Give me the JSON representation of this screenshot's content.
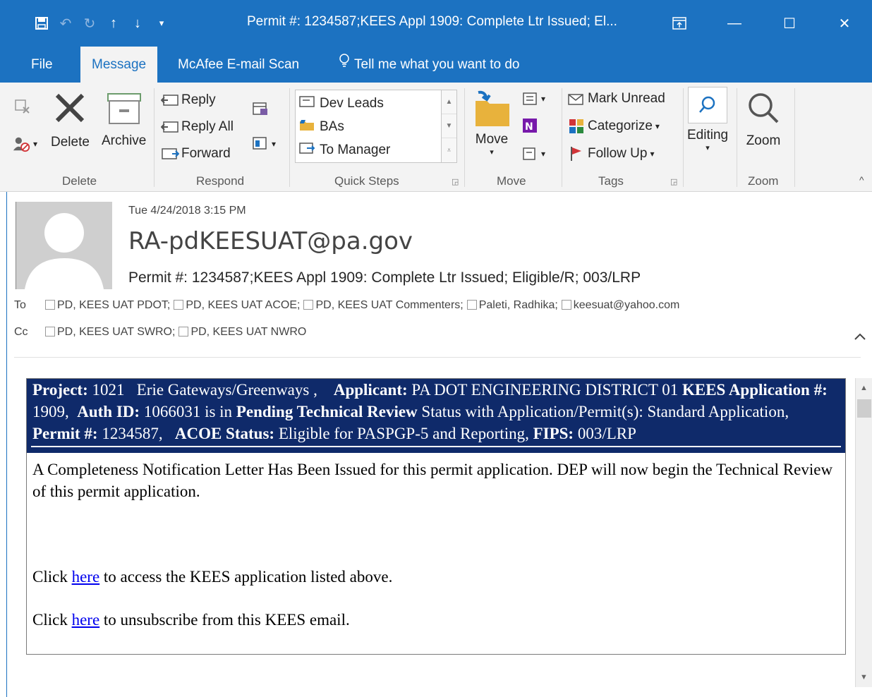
{
  "window": {
    "title": "Permit #: 1234587;KEES Appl 1909: Complete Ltr Issued; El...",
    "qat_icons": [
      "save-icon",
      "undo-icon",
      "redo-icon",
      "up-arrow-icon",
      "down-arrow-icon",
      "customize-icon"
    ],
    "controls": [
      "ribbon-display-icon",
      "minimize-icon",
      "maximize-icon",
      "close-icon"
    ]
  },
  "tabs": [
    {
      "label": "File"
    },
    {
      "label": "Message"
    },
    {
      "label": "McAfee E-mail Scan"
    },
    {
      "label": "Tell me what you want to do"
    }
  ],
  "ribbon": {
    "delete": {
      "delete_label": "Delete",
      "archive_label": "Archive",
      "group": "Delete"
    },
    "respond": {
      "reply": "Reply",
      "reply_all": "Reply All",
      "forward": "Forward",
      "group": "Respond"
    },
    "quick_steps": {
      "items": [
        "Dev Leads",
        "BAs",
        "To Manager"
      ],
      "group": "Quick Steps"
    },
    "move": {
      "move_label": "Move",
      "group": "Move"
    },
    "tags": {
      "mark_unread": "Mark Unread",
      "categorize": "Categorize",
      "follow_up": "Follow Up",
      "group": "Tags"
    },
    "editing": {
      "label": "Editing"
    },
    "zoom": {
      "label": "Zoom",
      "group": "Zoom"
    }
  },
  "header": {
    "date": "Tue 4/24/2018 3:15 PM",
    "sender": "RA-pdKEESUAT@pa.gov",
    "subject": "Permit #: 1234587;KEES Appl 1909: Complete Ltr Issued; Eligible/R; 003/LRP",
    "to_label": "To",
    "cc_label": "Cc",
    "to": [
      "PD, KEES UAT PDOT;",
      "PD, KEES UAT ACOE;",
      "PD, KEES UAT Commenters;",
      "Paleti, Radhika;",
      "keesuat@yahoo.com"
    ],
    "cc": [
      "PD, KEES UAT SWRO;",
      "PD, KEES UAT NWRO"
    ]
  },
  "body": {
    "banner": {
      "project_label": "Project:",
      "project_value": "1021   Erie Gateways/Greenways ,",
      "applicant_label": "Applicant:",
      "applicant_value": "PA DOT ENGINEERING DISTRICT 01",
      "app_label": "KEES Application #:",
      "app_value": "1909,",
      "auth_label": "Auth ID:",
      "auth_value": "1066031 is in",
      "status_label": "Pending Technical Review",
      "status_value": "Status with Application/Permit(s): Standard Application,",
      "permit_label": "Permit #:",
      "permit_value": "1234587,",
      "acoe_label": "ACOE Status:",
      "acoe_value": "Eligible for PASPGP-5 and Reporting,",
      "fips_label": "FIPS:",
      "fips_value": "003/LRP"
    },
    "paragraph": "A Completeness Notification Letter Has Been Issued for this permit application. DEP will now begin the Technical Review of this permit application.",
    "link1_pre": "Click ",
    "link1_text": "here",
    "link1_post": " to access the KEES application listed above.",
    "link2_pre": "Click ",
    "link2_text": "here",
    "link2_post": " to unsubscribe from this KEES email."
  }
}
